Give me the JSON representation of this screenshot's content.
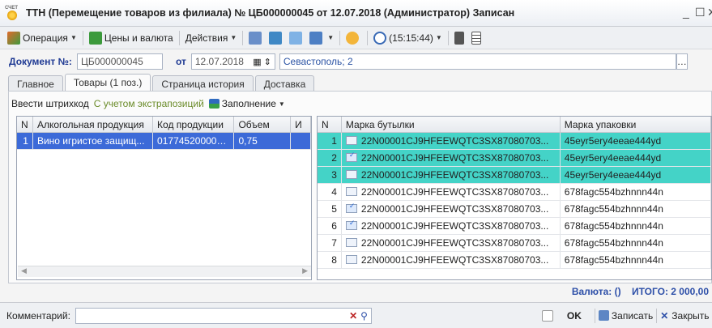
{
  "window": {
    "title": "ТТН (Перемещение товаров из филиала) № ЦБ000000045 от 12.07.2018 (Администратор) Записан",
    "app_icon_label": "СЧЕТ"
  },
  "toolbar": {
    "operation": "Операция",
    "prices": "Цены и валюта",
    "actions": "Действия",
    "time": "(15:15:44)"
  },
  "doc": {
    "number_label": "Документ №:",
    "number": "ЦБ000000045",
    "date_label": "от",
    "date": "12.07.2018",
    "org": "Севастополь; 2"
  },
  "tabs": [
    "Главное",
    "Товары (1 поз.)",
    "Страница история",
    "Доставка"
  ],
  "subtoolbar": {
    "barcode": "Ввести штрихкод",
    "expo": "С учетом экстрапозиций",
    "fill": "Заполнение"
  },
  "left_table": {
    "headers": [
      "N",
      "Алкогольная продукция",
      "Код продукции",
      "Объем",
      "И"
    ],
    "rows": [
      [
        "1",
        "Вино игристое защищ...",
        "017745200000...",
        "0,75",
        ""
      ]
    ]
  },
  "right_table": {
    "headers": [
      "N",
      "Марка бутылки",
      "Марка упаковки"
    ],
    "rows": [
      {
        "n": "1",
        "bottle": "22N00001CJ9HFEEWQTC3SX87080703...",
        "pack": "45eyr5ery4eeae444yd",
        "icon": "doc",
        "hl": true
      },
      {
        "n": "2",
        "bottle": "22N00001CJ9HFEEWQTC3SX87080703...",
        "pack": "45eyr5ery4eeae444yd",
        "icon": "check",
        "hl": true
      },
      {
        "n": "3",
        "bottle": "22N00001CJ9HFEEWQTC3SX87080703...",
        "pack": "45eyr5ery4eeae444yd",
        "icon": "doc",
        "hl": true
      },
      {
        "n": "4",
        "bottle": "22N00001CJ9HFEEWQTC3SX87080703...",
        "pack": "678fagc554bzhnnn44n",
        "icon": "doc",
        "hl": false
      },
      {
        "n": "5",
        "bottle": "22N00001CJ9HFEEWQTC3SX87080703...",
        "pack": "678fagc554bzhnnn44n",
        "icon": "check",
        "hl": false
      },
      {
        "n": "6",
        "bottle": "22N00001CJ9HFEEWQTC3SX87080703...",
        "pack": "678fagc554bzhnnn44n",
        "icon": "check",
        "hl": false
      },
      {
        "n": "7",
        "bottle": "22N00001CJ9HFEEWQTC3SX87080703...",
        "pack": "678fagc554bzhnnn44n",
        "icon": "doc",
        "hl": false
      },
      {
        "n": "8",
        "bottle": "22N00001CJ9HFEEWQTC3SX87080703...",
        "pack": "678fagc554bzhnnn44n",
        "icon": "doc",
        "hl": false
      }
    ]
  },
  "totals": {
    "currency": "Валюта: ()",
    "total": "ИТОГО: 2 000,00"
  },
  "bottom": {
    "comment_label": "Комментарий:",
    "comment_value": "",
    "ok": "OK",
    "save": "Записать",
    "close": "Закрыть"
  },
  "colors": {
    "highlight": "#44d3c7",
    "selected": "#3c6ad8",
    "label": "#1f3a93"
  }
}
